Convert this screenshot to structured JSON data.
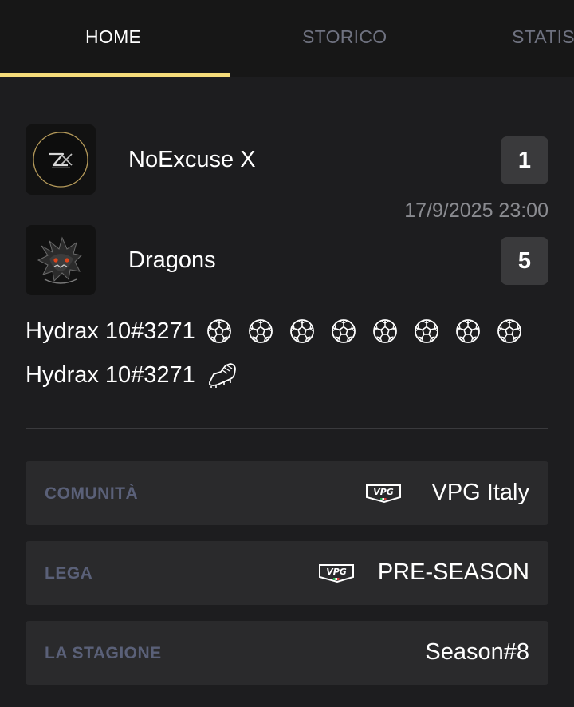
{
  "tabs": [
    {
      "label": "HOME",
      "active": true
    },
    {
      "label": "STORICO",
      "active": false
    },
    {
      "label": "STATIS",
      "active": false
    }
  ],
  "match": {
    "home": {
      "name": "NoExcuse X",
      "score": "1",
      "logo_icon": "noexcuse-x-logo"
    },
    "away": {
      "name": "Dragons",
      "score": "5",
      "logo_icon": "dragon-logo"
    },
    "datetime": "17/9/2025 23:00"
  },
  "events": [
    {
      "player": "Hydrax 10#3271",
      "icon": "soccer-ball-icon",
      "count": 8
    },
    {
      "player": "Hydrax 10#3271",
      "icon": "football-boot-icon",
      "count": 1
    }
  ],
  "info": {
    "community": {
      "label": "COMUNITÀ",
      "value": "VPG Italy",
      "icon": "vpg-logo-icon"
    },
    "league": {
      "label": "LEGA",
      "value": "PRE-SEASON",
      "icon": "vpg-logo-icon"
    },
    "season": {
      "label": "LA STAGIONE",
      "value": "Season#8"
    }
  },
  "colors": {
    "background": "#1d1d1f",
    "tabbar": "#171717",
    "accent": "#f5dc7a",
    "score_box": "#3a3a3c",
    "info_box": "#2a2a2c",
    "info_label": "#5a6078"
  }
}
